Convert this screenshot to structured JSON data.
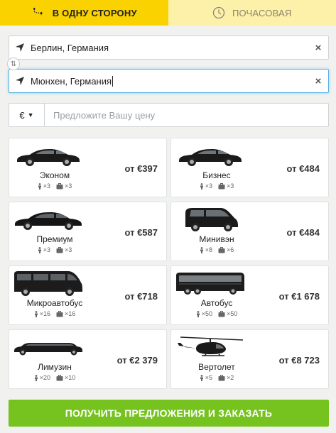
{
  "tabs": [
    {
      "label": "В одну сторону",
      "icon": "route-pin-icon"
    },
    {
      "label": "Почасовая",
      "icon": "clock-icon"
    }
  ],
  "from": {
    "value": "Берлин, Германия",
    "icon": "navigation-arrow-icon",
    "clear": "×"
  },
  "to": {
    "value": "Мюнхен, Германия",
    "icon": "navigation-arrow-icon",
    "clear": "×"
  },
  "swap": {
    "icon": "swap-arrows-icon",
    "glyph": "⇅"
  },
  "price": {
    "currency": "€",
    "caret": "▼",
    "placeholder": "Предложите Вашу цену"
  },
  "vehicles": [
    {
      "name": "Эконом",
      "price": "от €397",
      "pax": "×3",
      "bags": "×3",
      "kind": "sedan"
    },
    {
      "name": "Бизнес",
      "price": "от €484",
      "pax": "×3",
      "bags": "×3",
      "kind": "sedan"
    },
    {
      "name": "Премиум",
      "price": "от €587",
      "pax": "×3",
      "bags": "×3",
      "kind": "sedan-long"
    },
    {
      "name": "Минивэн",
      "price": "от €484",
      "pax": "×8",
      "bags": "×6",
      "kind": "minivan"
    },
    {
      "name": "Микроавтобус",
      "price": "от €718",
      "pax": "×16",
      "bags": "×16",
      "kind": "microbus"
    },
    {
      "name": "Автобус",
      "price": "от €1 678",
      "pax": "×50",
      "bags": "×50",
      "kind": "bus"
    },
    {
      "name": "Лимузин",
      "price": "от €2 379",
      "pax": "×20",
      "bags": "×10",
      "kind": "limo"
    },
    {
      "name": "Вертолет",
      "price": "от €8 723",
      "pax": "×5",
      "bags": "×2",
      "kind": "helicopter"
    }
  ],
  "cta": {
    "label": "Получить предложения и заказать"
  },
  "colors": {
    "tab_active": "#fad200",
    "tab_inactive": "#fdf0a8",
    "cta": "#76c320",
    "focus": "#59b0e8"
  }
}
